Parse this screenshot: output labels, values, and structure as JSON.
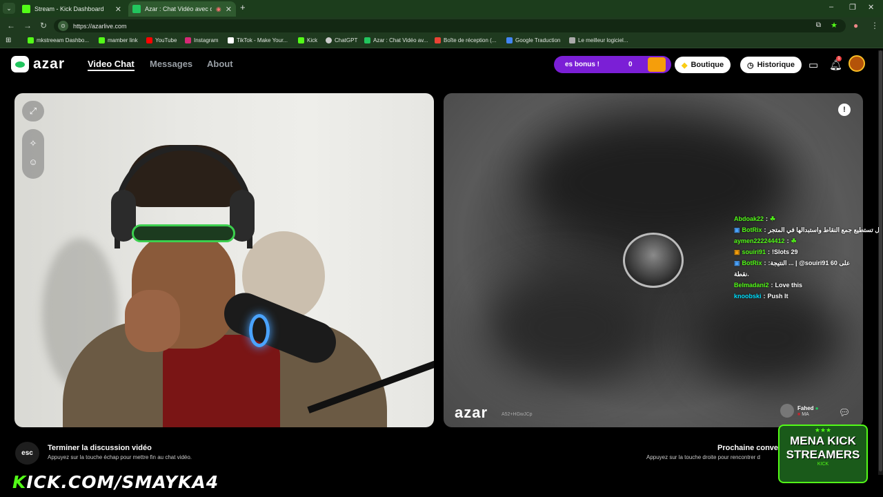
{
  "browser": {
    "tabs": [
      {
        "title": "Stream - Kick Dashboard",
        "active": false
      },
      {
        "title": "Azar : Chat Vidéo avec de n",
        "active": true
      }
    ],
    "new_tab": "+",
    "url": "https://azarlive.com",
    "bookmarks": [
      "mkstreeam Dashbo...",
      "mamber link",
      "YouTube",
      "Instagram",
      "TikTok - Make Your...",
      "Kick",
      "ChatGPT",
      "Azar : Chat Vidéo av...",
      "Boîte de réception (...",
      "Google Traduction",
      "Le meilleur logiciel..."
    ]
  },
  "app": {
    "logo": "azar",
    "nav": [
      "Video Chat",
      "Messages",
      "About"
    ],
    "active_nav": "Video Chat",
    "bonus_text": "es bonus !",
    "bonus_count": "0",
    "boutique": "Boutique",
    "historique": "Historique",
    "notification_count": "1"
  },
  "remote": {
    "watermark": "azar",
    "session_id": "A52+HGwJCp",
    "user_name": "Fahed",
    "user_country": "MA"
  },
  "chat": [
    {
      "user": "Abdoak22",
      "text": ""
    },
    {
      "user": "BotRix",
      "text": "ة الرسائل تستطيع جمع النقاط واستبدالها في المتجر"
    },
    {
      "user": "aymen222244412",
      "text": ""
    },
    {
      "user": "souiri91",
      "text": "!Slots 29"
    },
    {
      "user": "BotRix",
      "text": ":النتيجة ... | @souiri91 على 60"
    },
    {
      "user": "",
      "text": "نقطة."
    },
    {
      "user": "Belmadani2",
      "text": "Love this"
    },
    {
      "user": "knoobski",
      "text": "Push It"
    }
  ],
  "footer": {
    "esc_key": "esc",
    "end_title": "Terminer la discussion vidéo",
    "end_sub": "Appuyez sur la touche échap pour mettre fin au chat vidéo.",
    "next_title": "Prochaine conve",
    "next_sub": "Appuyez sur la touche droite pour rencontrer d"
  },
  "overlay": {
    "kick_url_prefix": "K",
    "kick_url_rest": "ICK.COM/SMAYKA4",
    "mena_stars": "★★★",
    "mena_line1": "MENA KICK",
    "mena_line2": "STREAMERS",
    "mena_line3": "KICK"
  },
  "colors": {
    "kick_green": "#53fc18",
    "bonus_purple": "#7b1fd6",
    "chrome_green": "#1f3a1f"
  }
}
